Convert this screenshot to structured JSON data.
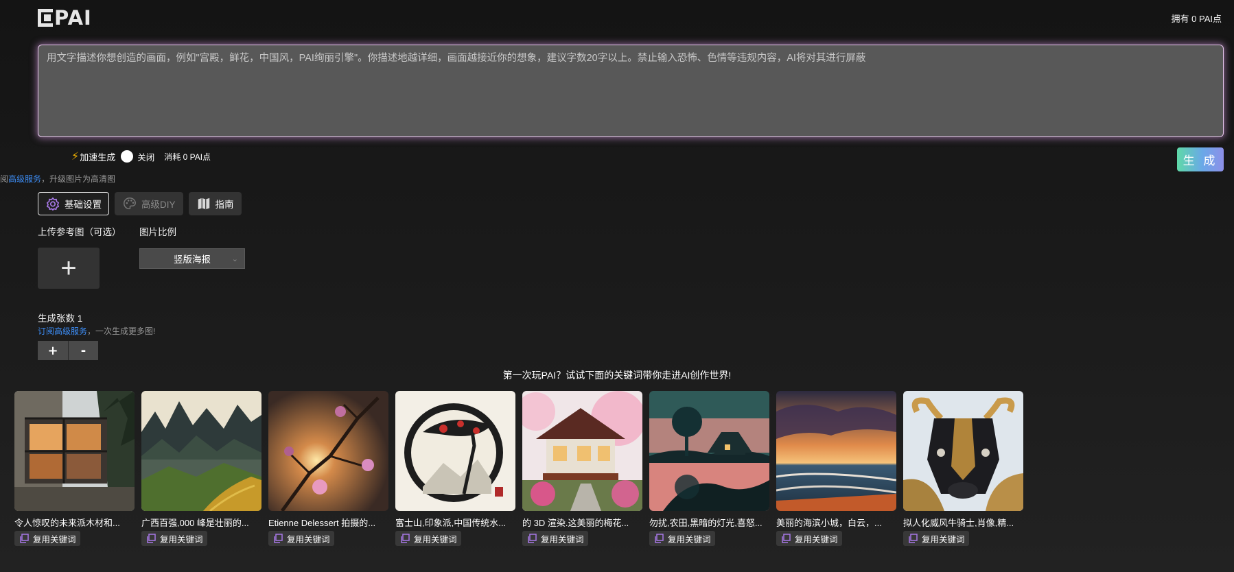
{
  "header": {
    "logo_text": "PAI",
    "points": "拥有 0 PAI点"
  },
  "prompt": {
    "placeholder": "用文字描述你想创造的画面，例如\"宫殿，鲜花，中国风，PAI绚丽引擎\"。你描述地越详细，画面越接近你的想象，建议字数20字以上。禁止输入恐怖、色情等违规内容，AI将对其进行屏蔽",
    "value": ""
  },
  "accel": {
    "label": "加速生成",
    "toggle": "关闭",
    "cost": "消耗 0 PAI点"
  },
  "generate_label": "生 成",
  "hd_note": {
    "prefix": "阅",
    "link": "高级服务",
    "suffix": "，升级图片为高清图"
  },
  "tabs": [
    {
      "label": "基础设置"
    },
    {
      "label": "高级DIY"
    },
    {
      "label": "指南"
    }
  ],
  "upload_label": "上传参考图（可选）",
  "ratio": {
    "label": "图片比例",
    "selected": "竖版海报"
  },
  "count": {
    "label": "生成张数 1",
    "note_link": "订阅高级服务",
    "note_suffix": "，一次生成更多图!",
    "plus": "+",
    "minus": "-"
  },
  "tip": "第一次玩PAI？试试下面的关键词带你走进AI创作世界!",
  "gallery": [
    {
      "caption": "令人惊叹的未来派木材和..."
    },
    {
      "caption": "广西百强,000 峰是壮丽的..."
    },
    {
      "caption": "Etienne Delessert 拍摄的..."
    },
    {
      "caption": "富士山,印象派,中国传统水..."
    },
    {
      "caption": "的 3D 渲染.这美丽的梅花..."
    },
    {
      "caption": "勿扰,农田,黑暗的灯光,喜怒..."
    },
    {
      "caption": "美丽的海滨小城，白云，..."
    },
    {
      "caption": "拟人化威风牛骑士,肖像,精..."
    }
  ],
  "copy_label": "复用关键词",
  "colors": {
    "accent_link": "#3d8ef7",
    "bolt": "#f5b400",
    "prompt_glow": "#e9c8ef",
    "tab_icon": "#a879e8"
  }
}
